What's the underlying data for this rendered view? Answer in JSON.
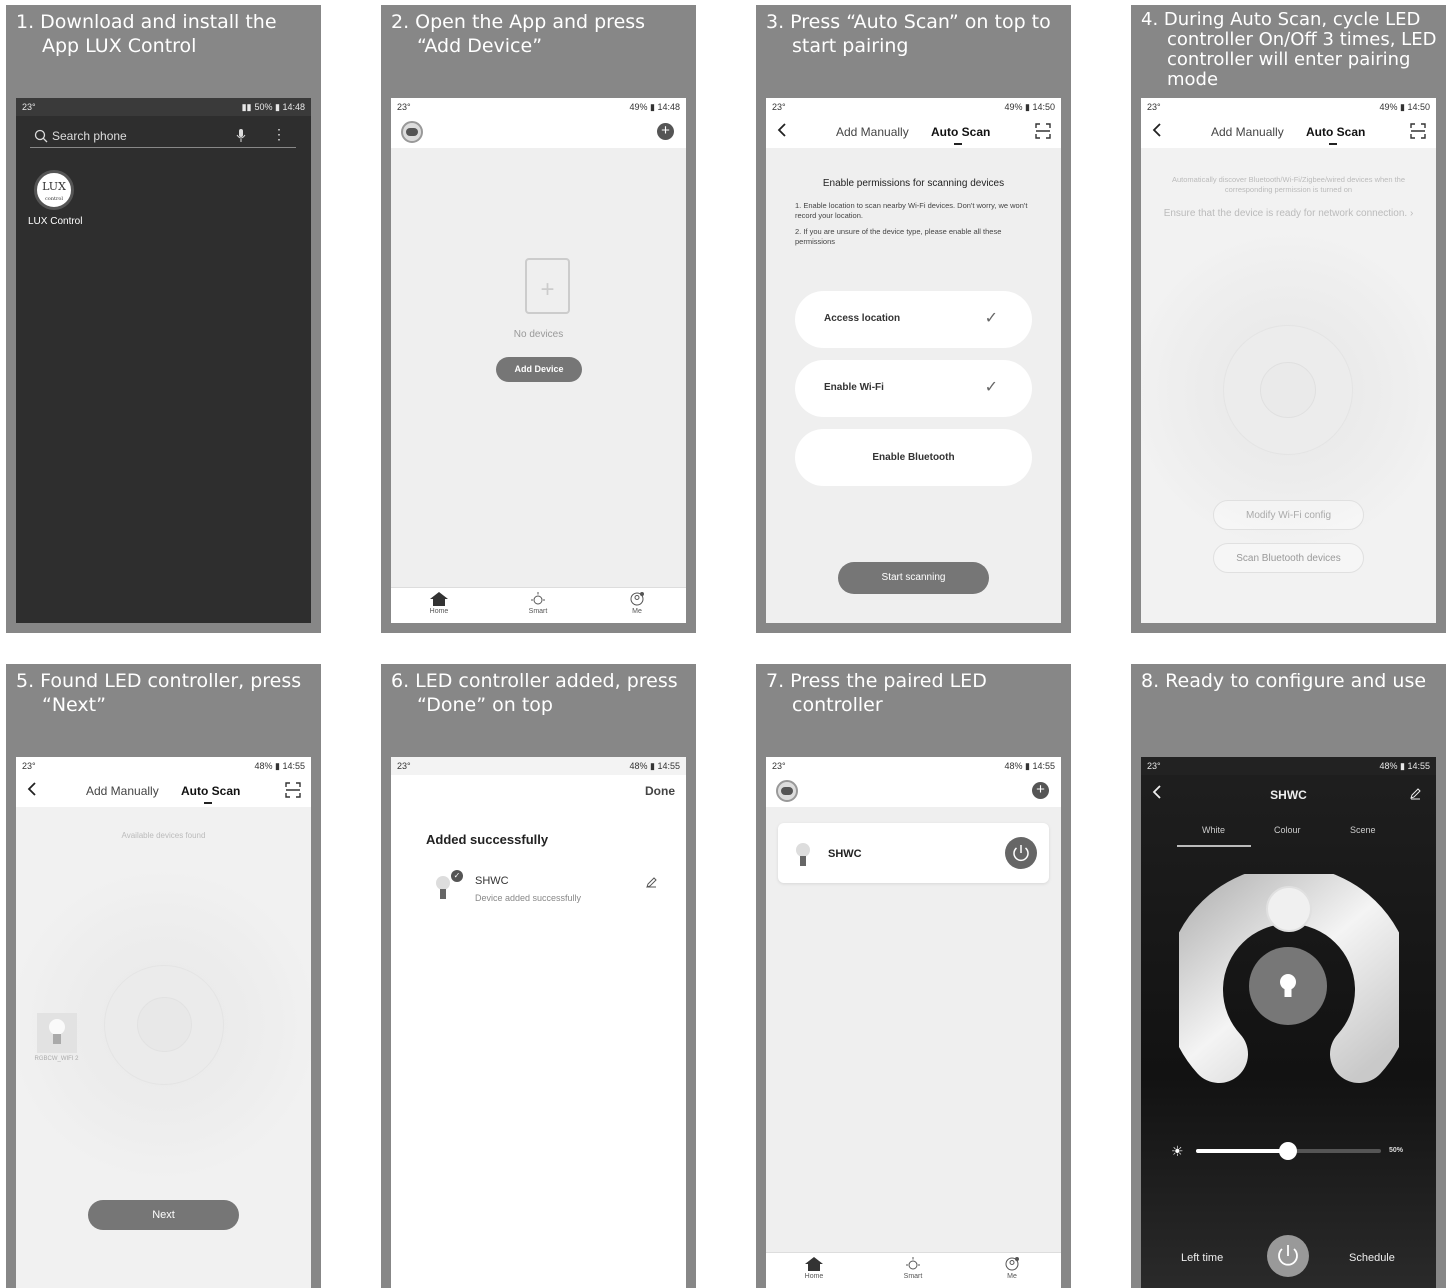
{
  "steps": [
    {
      "title": "1. Download and install the App LUX Control"
    },
    {
      "title": "2. Open the App and press “Add Device”"
    },
    {
      "title": "3. Press “Auto Scan” on top to start pairing"
    },
    {
      "title": "4. During Auto Scan, cycle LED controller On/Off 3 times, LED controller will enter pairing mode"
    },
    {
      "title": "5. Found LED controller, press “Next”"
    },
    {
      "title": "6. LED controller added, press “Done” on top"
    },
    {
      "title": "7. Press the paired LED controller"
    },
    {
      "title": "8. Ready to configure and use"
    }
  ],
  "status": {
    "s1": {
      "left": "23°",
      "right": "50% ▮ 14:48"
    },
    "s2": {
      "left": "23°",
      "right": "49% ▮ 14:48"
    },
    "s3": {
      "left": "23°",
      "right": "49% ▮ 14:50"
    },
    "s4": {
      "left": "23°",
      "right": "49% ▮ 14:50"
    },
    "s5": {
      "left": "23°",
      "right": "48% ▮ 14:55"
    },
    "s6": {
      "left": "23°",
      "right": "48% ▮ 14:55"
    },
    "s7": {
      "left": "23°",
      "right": "48% ▮ 14:55"
    },
    "s8": {
      "left": "23°",
      "right": "48% ▮ 14:55"
    }
  },
  "screen1": {
    "search_placeholder": "Search phone",
    "app_label": "LUX Control",
    "logo_text": "LUX",
    "logo_sub": "control"
  },
  "screen2": {
    "empty_text": "No devices",
    "add_button": "Add Device"
  },
  "nav": {
    "home": "Home",
    "smart": "Smart",
    "me": "Me"
  },
  "tabs": {
    "manual": "Add Manually",
    "auto": "Auto Scan"
  },
  "screen3": {
    "heading": "Enable permissions for scanning devices",
    "p1": "1. Enable location to scan nearby Wi-Fi devices. Don't worry, we won't record your location.",
    "p2": "2. If you are unsure of the device type, please enable all these permissions",
    "btn_location": "Access location",
    "btn_wifi": "Enable Wi-Fi",
    "btn_bluetooth": "Enable Bluetooth",
    "start": "Start scanning"
  },
  "screen4": {
    "hint": "Automatically discover Bluetooth/Wi-Fi/Zigbee/wired devices when the corresponding permission is turned on",
    "ensure": "Ensure that the device is ready for network connection. ›",
    "modify": "Modify Wi-Fi config",
    "scan_bt": "Scan Bluetooth devices"
  },
  "screen5": {
    "found": "Available devices found",
    "device_label": "RGBCW_WIFI 2",
    "next": "Next"
  },
  "screen6": {
    "done": "Done",
    "heading": "Added successfully",
    "device": "SHWC",
    "sub": "Device added successfully"
  },
  "screen7": {
    "device": "SHWC"
  },
  "screen8": {
    "title": "SHWC",
    "tab_white": "White",
    "tab_colour": "Colour",
    "tab_scene": "Scene",
    "brightness": "50%",
    "left_time": "Left time",
    "schedule": "Schedule"
  }
}
